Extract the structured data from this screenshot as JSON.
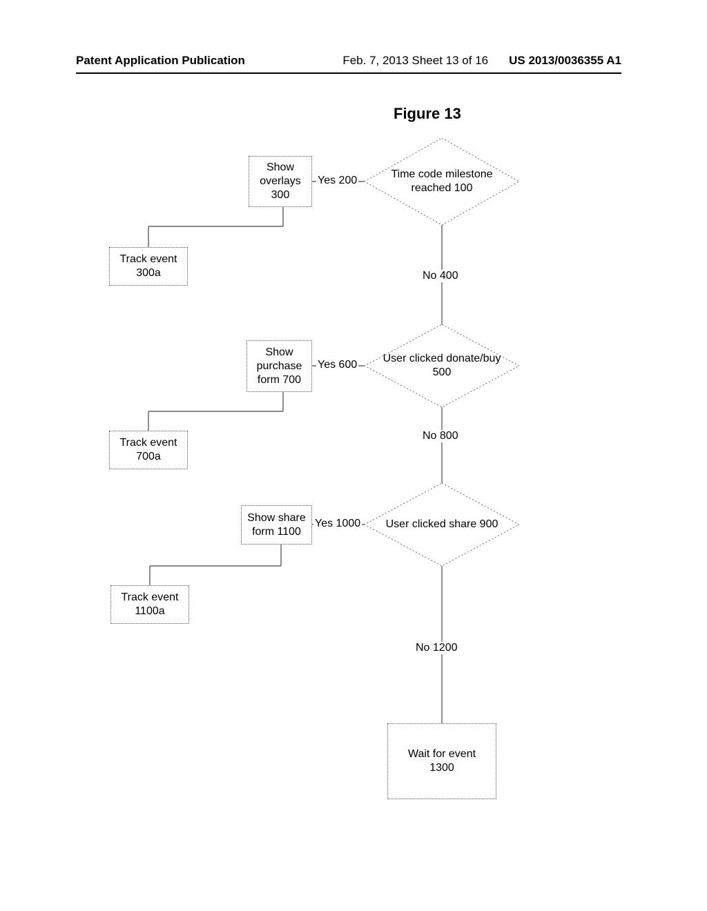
{
  "header": {
    "left": "Patent Application Publication",
    "mid": "Feb. 7, 2013  Sheet 13 of 16",
    "right": "US 2013/0036355 A1"
  },
  "figure_title": "Figure 13",
  "nodes": {
    "dec_100": "Time code milestone reached 100",
    "box_300_l1": "Show",
    "box_300_l2": "overlays",
    "box_300_l3": "300",
    "box_300a_l1": "Track event",
    "box_300a_l2": "300a",
    "dec_500": "User clicked donate/buy 500",
    "box_700_l1": "Show",
    "box_700_l2": "purchase",
    "box_700_l3": "form  700",
    "box_700a_l1": "Track event",
    "box_700a_l2": "700a",
    "dec_900": "User clicked share 900",
    "box_1100_l1": "Show share",
    "box_1100_l2": "form 1100",
    "box_1100a_l1": "Track event",
    "box_1100a_l2": "1100a",
    "box_1300_l1": "Wait for event",
    "box_1300_l2": "1300"
  },
  "edges": {
    "yes_200": "Yes 200",
    "no_400": "No 400",
    "yes_600": "Yes 600",
    "no_800": "No 800",
    "yes_1000": "Yes 1000",
    "no_1200": "No 1200"
  }
}
